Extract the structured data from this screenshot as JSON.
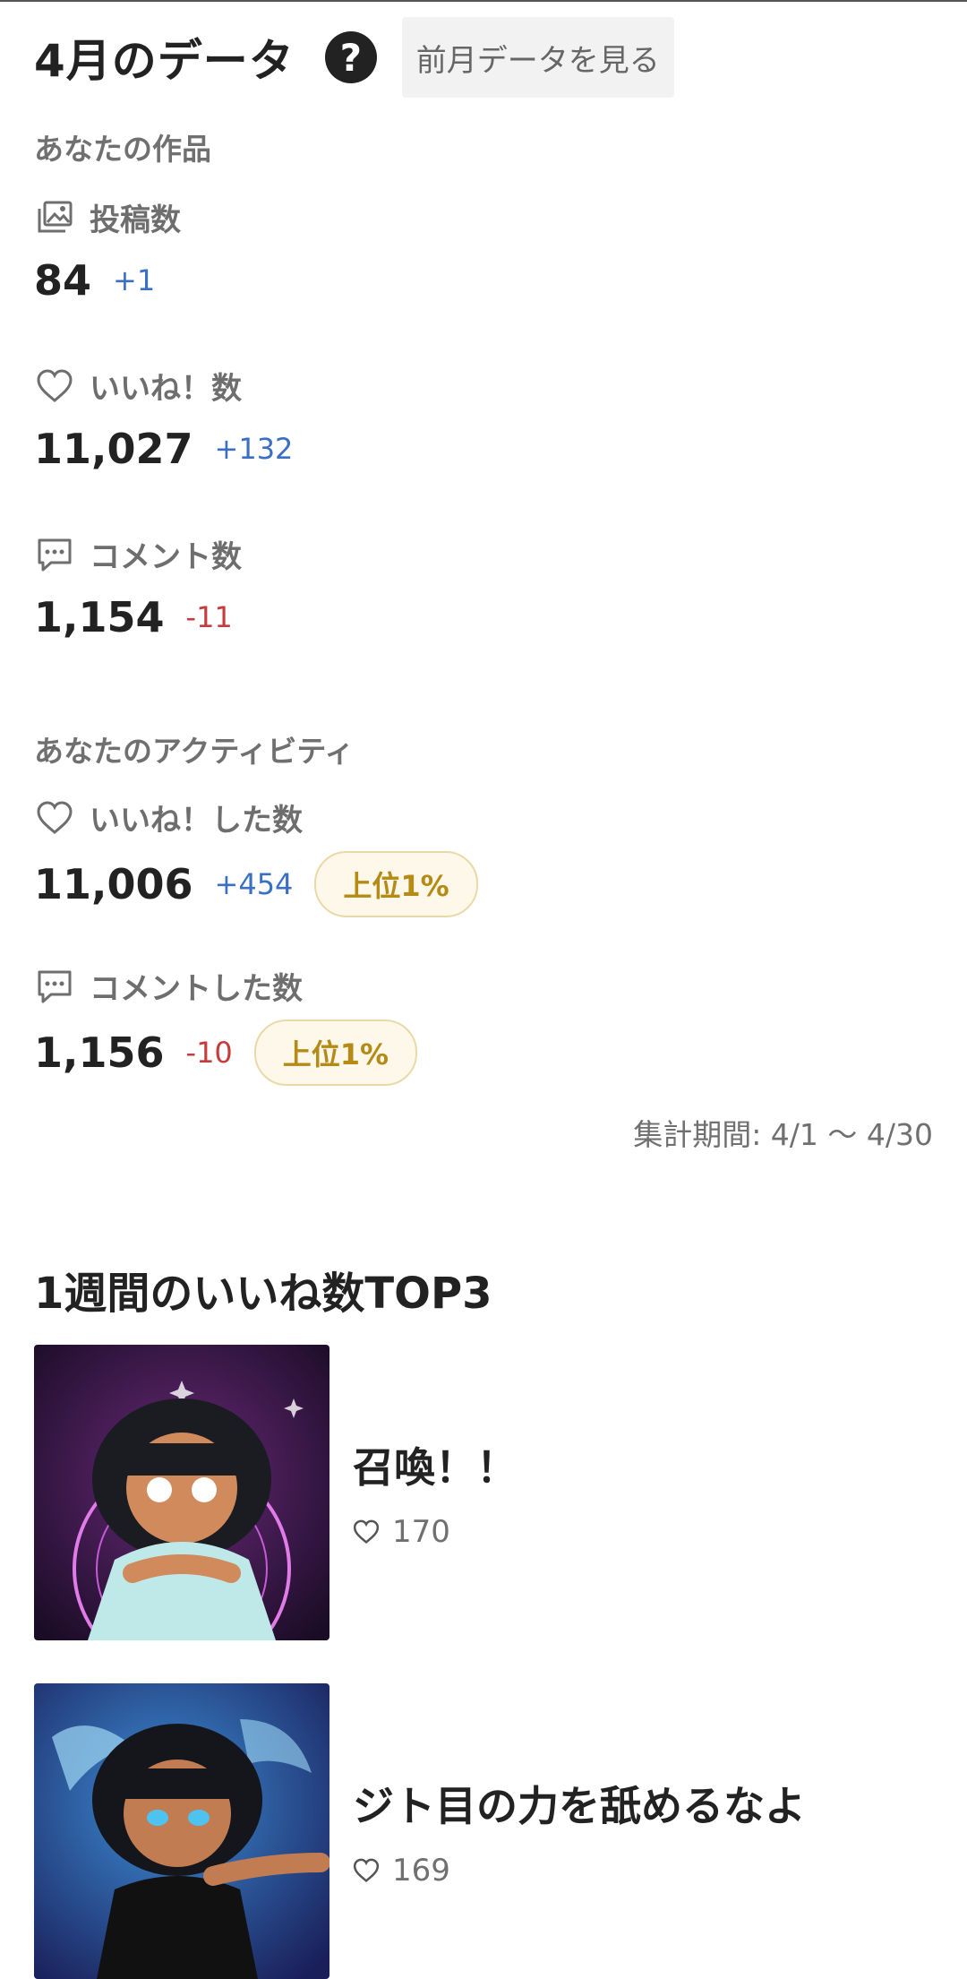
{
  "header": {
    "title": "4月のデータ",
    "help_glyph": "?",
    "prev_button": "前月データを見る"
  },
  "works_section": {
    "title": "あなたの作品",
    "metrics": [
      {
        "label": "投稿数",
        "icon": "images-icon",
        "value": "84",
        "delta": "+1",
        "direction": "up"
      },
      {
        "label": "いいね！数",
        "icon": "heart-icon",
        "value": "11,027",
        "delta": "+132",
        "direction": "up"
      },
      {
        "label": "コメント数",
        "icon": "comment-icon",
        "value": "1,154",
        "delta": "-11",
        "direction": "down"
      }
    ]
  },
  "activity_section": {
    "title": "あなたのアクティビティ",
    "metrics": [
      {
        "label": "いいね！した数",
        "icon": "heart-icon",
        "value": "11,006",
        "delta": "+454",
        "direction": "up",
        "rank": "上位1%"
      },
      {
        "label": "コメントした数",
        "icon": "comment-icon",
        "value": "1,156",
        "delta": "-10",
        "direction": "down",
        "rank": "上位1%"
      }
    ]
  },
  "period": "集計期間: 4/1 〜 4/30",
  "top3": {
    "title": "1週間のいいね数TOP3",
    "items": [
      {
        "title": "召喚！！",
        "likes": "170"
      },
      {
        "title": "ジト目の力を舐めるなよ",
        "likes": "169"
      }
    ]
  },
  "colors": {
    "accent_up": "#3a6fc4",
    "accent_down": "#c63b3b",
    "badge_text": "#b58a17",
    "badge_bg": "#fdf8ea"
  }
}
